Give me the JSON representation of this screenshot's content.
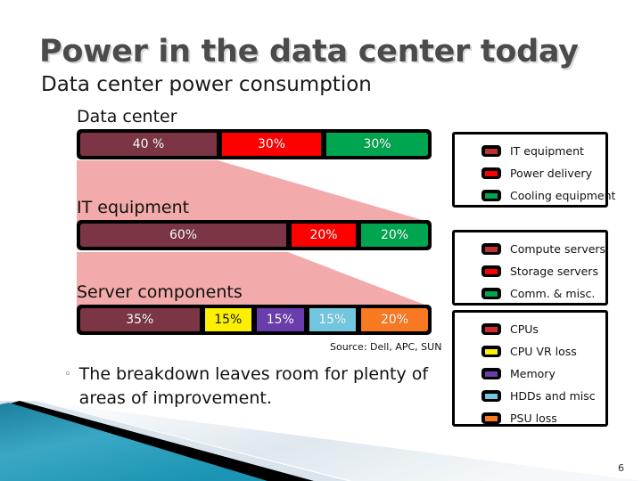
{
  "slide": {
    "title": "Power in the data center today",
    "subtitle": "Data center power consumption",
    "source_note": "Source: Dell, APC, SUN",
    "page_number": "6",
    "bullet_marker": "◦",
    "bullet_text": "The breakdown leaves room for plenty of areas of improvement."
  },
  "colors": {
    "maroon": "#7b3545",
    "red": "#fe0000",
    "green": "#00a550",
    "yellow": "#fcf000",
    "purple": "#6a3dad",
    "lightblue": "#72c7e0",
    "orange": "#f97822",
    "funnel_pink": "#f2aaaa",
    "title_gray": "#4b4b4b",
    "decor_teal": "#2e9ab8"
  },
  "chart_data": [
    {
      "type": "bar",
      "title": "Data center",
      "orientation": "horizontal-stacked",
      "categories": [
        "IT equipment",
        "Power delivery",
        "Cooling equipment"
      ],
      "values": [
        40,
        30,
        30
      ],
      "labels": [
        "40 %",
        "30%",
        "30%"
      ],
      "colors": [
        "#7b3545",
        "#fe0000",
        "#00a550"
      ],
      "ylabel": "",
      "xlabel": "",
      "total": 100,
      "unit": "%"
    },
    {
      "type": "bar",
      "title": "IT equipment",
      "orientation": "horizontal-stacked",
      "categories": [
        "Compute servers",
        "Storage servers",
        "Comm. & misc."
      ],
      "values": [
        60,
        20,
        20
      ],
      "labels": [
        "60%",
        "20%",
        "20%"
      ],
      "colors": [
        "#7b3545",
        "#fe0000",
        "#00a550"
      ],
      "ylabel": "",
      "xlabel": "",
      "total": 100,
      "unit": "%"
    },
    {
      "type": "bar",
      "title": "Server components",
      "orientation": "horizontal-stacked",
      "categories": [
        "CPUs",
        "CPU VR loss",
        "Memory",
        "HDDs and misc",
        "PSU loss"
      ],
      "values": [
        35,
        15,
        15,
        15,
        20
      ],
      "labels": [
        "35%",
        "15%",
        "15%",
        "15%",
        "20%"
      ],
      "colors": [
        "#7b3545",
        "#fcf000",
        "#6a3dad",
        "#72c7e0",
        "#f97822"
      ],
      "ylabel": "",
      "xlabel": "",
      "total": 100,
      "unit": "%"
    }
  ],
  "legends": [
    {
      "name": "data-center-legend",
      "items": [
        {
          "label": "IT equipment",
          "color": "#c03030"
        },
        {
          "label": "Power delivery",
          "color": "#fe0000"
        },
        {
          "label": "Cooling equipment",
          "color": "#00a550"
        }
      ]
    },
    {
      "name": "it-equipment-legend",
      "items": [
        {
          "label": "Compute servers",
          "color": "#c03030"
        },
        {
          "label": "Storage servers",
          "color": "#fe0000"
        },
        {
          "label": "Comm. & misc.",
          "color": "#00a550"
        }
      ]
    },
    {
      "name": "server-components-legend",
      "items": [
        {
          "label": "CPUs",
          "color": "#d02a2a"
        },
        {
          "label": "CPU VR loss",
          "color": "#fcf000"
        },
        {
          "label": "Memory",
          "color": "#6a3dad"
        },
        {
          "label": "HDDs and misc",
          "color": "#72c7e0"
        },
        {
          "label": "PSU loss",
          "color": "#f97822"
        }
      ]
    }
  ]
}
